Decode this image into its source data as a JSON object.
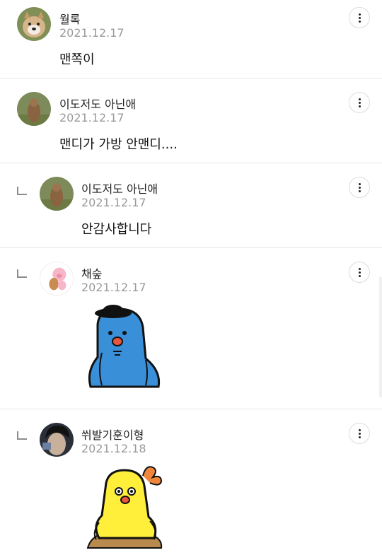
{
  "comments": [
    {
      "author": "월록",
      "date": "2021.12.17",
      "text": "맨쪽이",
      "avatar_icon": "shiba-dog-avatar",
      "more_icon": "more-vertical-icon"
    },
    {
      "author": "이도저도 아닌애",
      "date": "2021.12.17",
      "text": "맨디가 가방 안맨디....",
      "avatar_icon": "animal-photo-avatar",
      "more_icon": "more-vertical-icon"
    },
    {
      "author": "이도저도 아닌애",
      "date": "2021.12.17",
      "text": "안감사합니다",
      "avatar_icon": "animal-photo-avatar",
      "more_icon": "more-vertical-icon",
      "is_reply": true
    },
    {
      "author": "채숲",
      "date": "2021.12.17",
      "sticker": "blue-bird-sticker",
      "avatar_icon": "cartoon-pig-avatar",
      "more_icon": "more-vertical-icon",
      "is_reply": true
    },
    {
      "author": "쒸발기훈이형",
      "date": "2021.12.18",
      "sticker": "yellow-chick-sticker",
      "avatar_icon": "person-photo-avatar",
      "more_icon": "more-vertical-icon",
      "is_reply": true
    }
  ],
  "colors": {
    "date": "#9a9a9a",
    "divider": "#e8e8e8",
    "sticker_blue": "#3a8fd9",
    "sticker_yellow": "#ffee3a"
  }
}
